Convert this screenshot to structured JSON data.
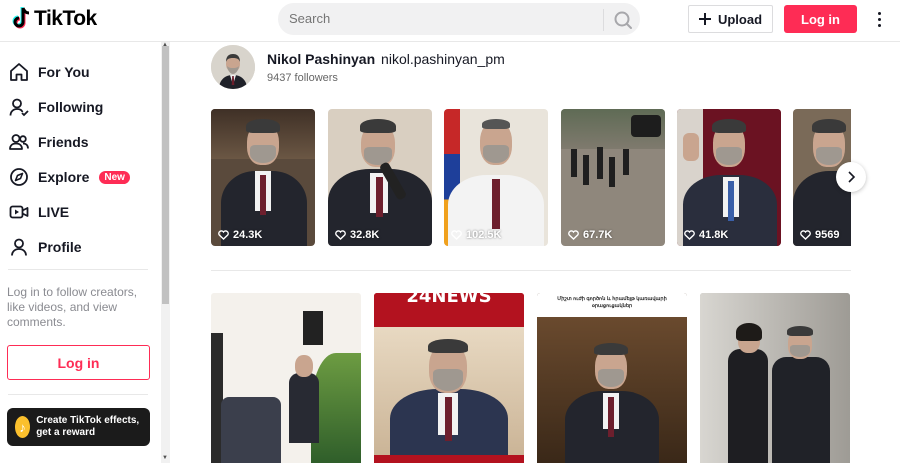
{
  "header": {
    "logo_text": "TikTok",
    "search_placeholder": "Search",
    "upload_label": "Upload",
    "login_label": "Log in"
  },
  "sidebar": {
    "nav": [
      {
        "label": "For You",
        "icon": "home-icon"
      },
      {
        "label": "Following",
        "icon": "following-icon"
      },
      {
        "label": "Friends",
        "icon": "friends-icon"
      },
      {
        "label": "Explore",
        "icon": "explore-icon",
        "badge": "New"
      },
      {
        "label": "LIVE",
        "icon": "live-icon"
      },
      {
        "label": "Profile",
        "icon": "profile-icon"
      }
    ],
    "login_prompt": "Log in to follow creators, like videos, and view comments.",
    "login_button": "Log in",
    "effects_banner": "Create TikTok effects, get a reward"
  },
  "profile": {
    "name": "Nikol Pashinyan",
    "handle": "nikol.pashinyan_pm",
    "followers": "9437 followers"
  },
  "videos_row1": [
    {
      "likes": "24.3K",
      "palette": "#5a4a3c"
    },
    {
      "likes": "32.8K",
      "palette": "#d9cfc1"
    },
    {
      "likes": "102.5K",
      "palette": "#e9e4db"
    },
    {
      "likes": "67.7K",
      "palette": "#8f877c"
    },
    {
      "likes": "41.8K",
      "palette": "#6b1222"
    },
    {
      "likes": "9569",
      "palette": "#7a6a58"
    }
  ],
  "videos_row2": [
    {
      "overlay": "",
      "palette": "#f4f1ec"
    },
    {
      "overlay": "24NEWS",
      "palette": "#c4182b"
    },
    {
      "overlay": "Միշտ ուժի գործոն և հրամեյթ կառավարի օրացուցակներ",
      "palette": "#4a3424"
    },
    {
      "overlay": "",
      "palette": "#b8b6b1"
    }
  ],
  "colors": {
    "brand": "#fe2c55",
    "text": "#161823",
    "muted": "#8a8b91"
  }
}
